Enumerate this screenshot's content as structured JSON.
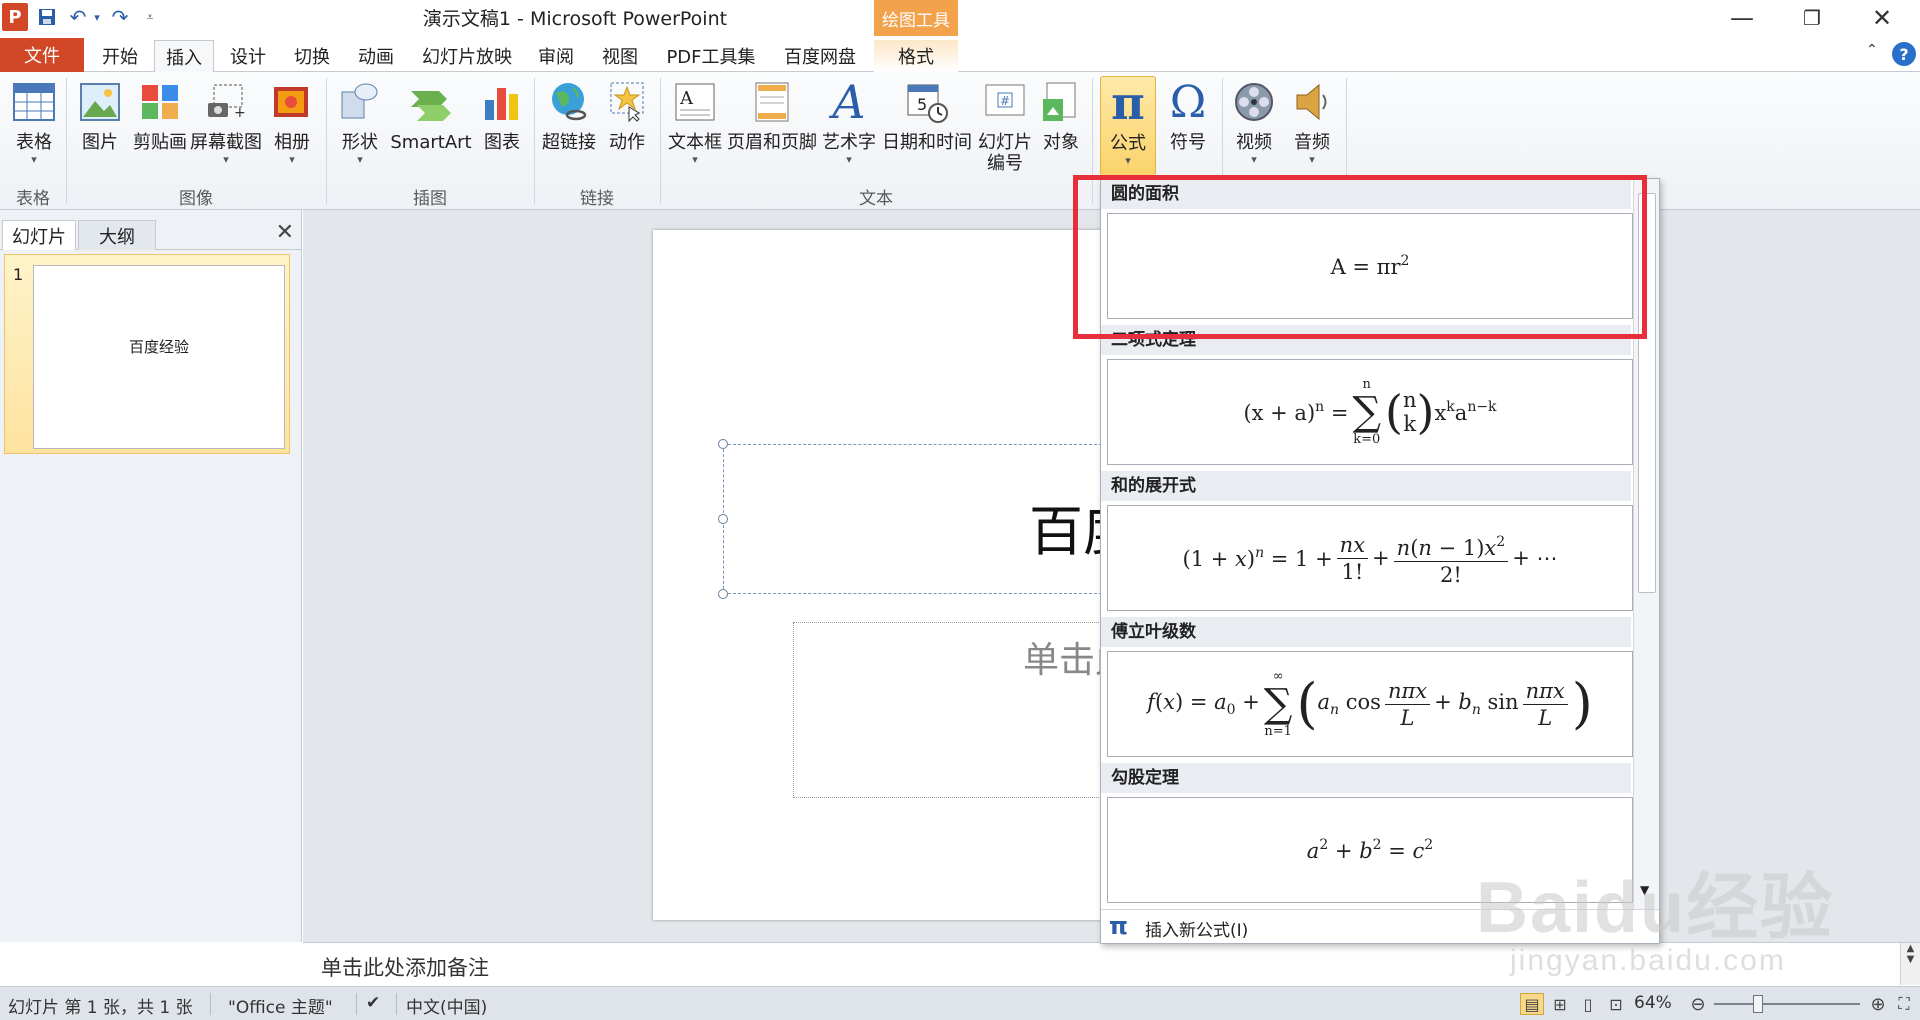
{
  "window": {
    "title": "演示文稿1 - Microsoft PowerPoint",
    "context_tool_header": "绘图工具",
    "app_logo": "P",
    "controls": {
      "minimize": "—",
      "restore": "❐",
      "close": "✕"
    }
  },
  "quick_access": {
    "save_icon": "save-icon",
    "undo_icon": "undo-icon",
    "redo_icon": "redo-icon"
  },
  "tabs": [
    {
      "label": "文件"
    },
    {
      "label": "开始"
    },
    {
      "label": "插入"
    },
    {
      "label": "设计"
    },
    {
      "label": "切换"
    },
    {
      "label": "动画"
    },
    {
      "label": "幻灯片放映"
    },
    {
      "label": "审阅"
    },
    {
      "label": "视图"
    },
    {
      "label": "PDF工具集"
    },
    {
      "label": "百度网盘"
    },
    {
      "label": "格式"
    }
  ],
  "ribbon": {
    "buttons": {
      "table": "表格",
      "picture": "图片",
      "clipart": "剪贴画",
      "screenshot": "屏幕截图",
      "album": "相册",
      "shapes": "形状",
      "smartart": "SmartArt",
      "chart": "图表",
      "hyperlink": "超链接",
      "action": "动作",
      "textbox": "文本框",
      "header_footer": "页眉和页脚",
      "wordart": "艺术字",
      "datetime": "日期和时间",
      "slide_number_1": "幻灯片",
      "slide_number_2": "编号",
      "object": "对象",
      "equation": "公式",
      "symbol": "符号",
      "video": "视频",
      "audio": "音频"
    },
    "groups": {
      "tables": "表格",
      "images": "图像",
      "illustrations": "插图",
      "links": "链接",
      "text": "文本"
    }
  },
  "left_panel": {
    "tab_slides": "幻灯片",
    "tab_outline": "大纲",
    "close": "✕",
    "thumbnail_number": "1",
    "thumbnail_title": "百度经验"
  },
  "slide": {
    "title": "百度",
    "subtitle": "单击此处添"
  },
  "notes": {
    "placeholder": "单击此处添加备注"
  },
  "equation_gallery": {
    "items": [
      {
        "name": "圆的面积"
      },
      {
        "name": "二项式定理"
      },
      {
        "name": "和的展开式"
      },
      {
        "name": "傅立叶级数"
      },
      {
        "name": "勾股定理"
      }
    ],
    "footer_icon": "π",
    "footer_label": "插入新公式(I)"
  },
  "status_bar": {
    "slide_info": "幻灯片 第 1 张，共 1 张",
    "theme": "\"Office 主题\"",
    "language": "中文(中国)",
    "zoom": "64%",
    "zoom_value": 64
  },
  "watermark": {
    "brand": "Baidu经验",
    "url": "jingyan.baidu.com"
  },
  "colors": {
    "file_tab": "#d24726",
    "highlight_border": "#e62e3c",
    "context_tab": "#f2a24a"
  }
}
